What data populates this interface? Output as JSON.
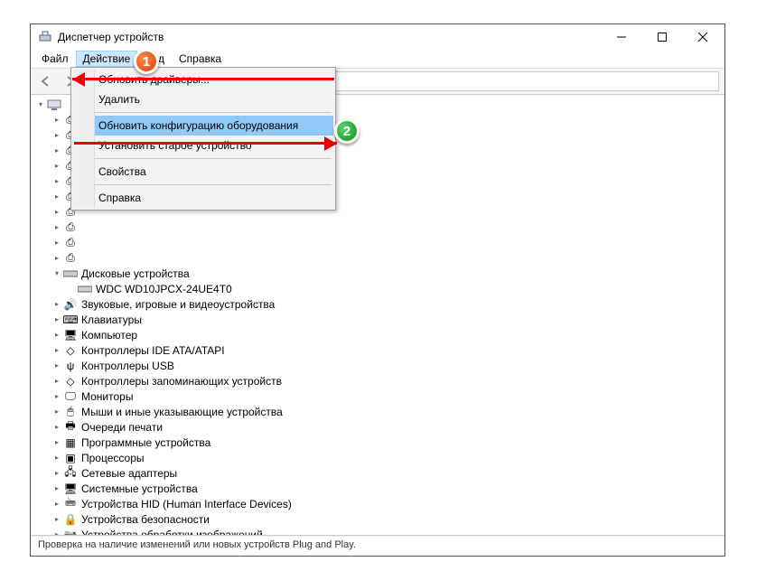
{
  "window": {
    "title": "Диспетчер устройств"
  },
  "menubar": {
    "file": "Файл",
    "action": "Действие",
    "view": "Вид",
    "help": "Справка"
  },
  "dropdown": {
    "update_drivers": "Обновить драйверы...",
    "remove": "Удалить",
    "scan_hardware": "Обновить конфигурацию оборудования",
    "add_legacy": "Установить старое устройство",
    "properties": "Свойства",
    "help": "Справка"
  },
  "tree": {
    "disk_drives": "Дисковые устройства",
    "disk_item": "WDC WD10JPCX-24UE4T0",
    "audio": "Звуковые, игровые и видеоустройства",
    "keyboards": "Клавиатуры",
    "computer": "Компьютер",
    "ide": "Контроллеры IDE ATA/ATAPI",
    "usb": "Контроллеры USB",
    "storage_ctrl": "Контроллеры запоминающих устройств",
    "monitors": "Мониторы",
    "mice": "Мыши и иные указывающие устройства",
    "print_queues": "Очереди печати",
    "software_dev": "Программные устройства",
    "processors": "Процессоры",
    "net_adapters": "Сетевые адаптеры",
    "system_dev": "Системные устройства",
    "hid": "Устройства HID (Human Interface Devices)",
    "security_dev": "Устройства безопасности",
    "imaging": "Устройства обработки изображений"
  },
  "status": "Проверка на наличие изменений или новых устройств Plug and Play.",
  "markers": {
    "one": "1",
    "two": "2"
  }
}
